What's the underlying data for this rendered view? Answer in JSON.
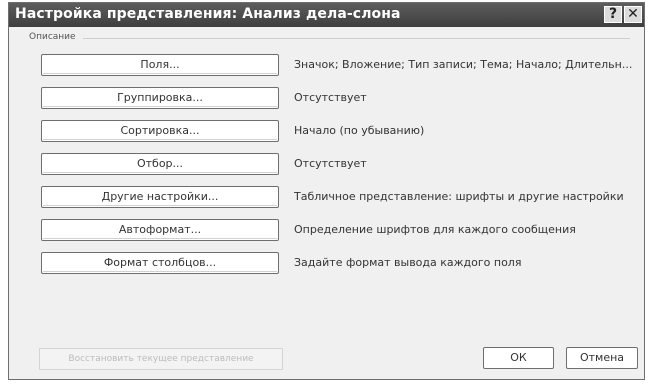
{
  "window": {
    "title": "Настройка представления: Анализ дела-слона",
    "help_label": "?",
    "close_label": "✕"
  },
  "description_label": "Описание",
  "rows": [
    {
      "button": "Поля...",
      "value": "Значок; Вложение; Тип записи; Тема; Начало; Длительн..."
    },
    {
      "button": "Группировка...",
      "value": "Отсутствует"
    },
    {
      "button": "Сортировка...",
      "value": "Начало (по убыванию)"
    },
    {
      "button": "Отбор...",
      "value": "Отсутствует"
    },
    {
      "button": "Другие настройки...",
      "value": "Табличное представление: шрифты и другие настройки"
    },
    {
      "button": "Автоформат...",
      "value": "Определение шрифтов для каждого сообщения"
    },
    {
      "button": "Формат столбцов...",
      "value": "Задайте формат вывода каждого поля"
    }
  ],
  "footer": {
    "restore_label": "Восстановить текущее представление",
    "ok_label": "ОК",
    "cancel_label": "Отмена"
  }
}
